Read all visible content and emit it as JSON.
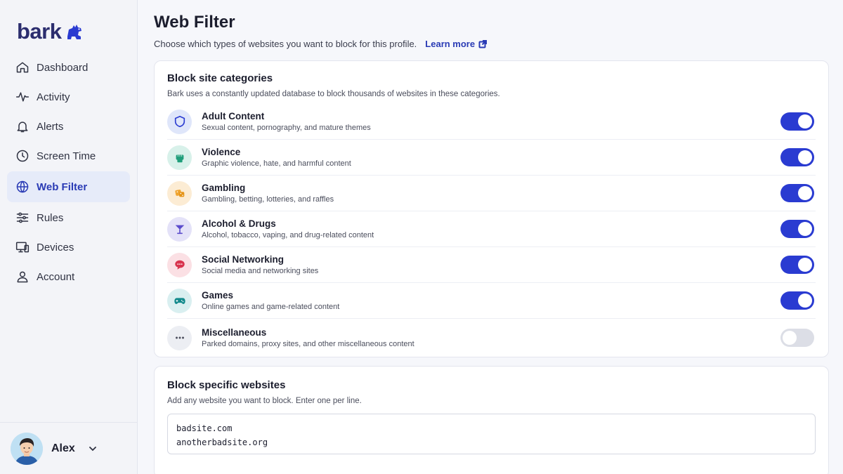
{
  "brand": {
    "name": "bark",
    "accent": "#2a3bd1",
    "logo_color": "#2b2d6e"
  },
  "sidebar": {
    "items": [
      {
        "label": "Dashboard",
        "icon": "home-icon",
        "active": false
      },
      {
        "label": "Activity",
        "icon": "pulse-icon",
        "active": false
      },
      {
        "label": "Alerts",
        "icon": "bell-icon",
        "active": false
      },
      {
        "label": "Screen Time",
        "icon": "clock-icon",
        "active": false
      },
      {
        "label": "Web Filter",
        "icon": "globe-icon",
        "active": true
      },
      {
        "label": "Rules",
        "icon": "sliders-icon",
        "active": false
      },
      {
        "label": "Devices",
        "icon": "devices-icon",
        "active": false
      },
      {
        "label": "Account",
        "icon": "user-icon",
        "active": false
      }
    ],
    "user": {
      "name": "Alex"
    }
  },
  "page": {
    "title": "Web Filter",
    "subtitle": "Choose which types of websites you want to block for this profile.",
    "learn_more": "Learn more"
  },
  "categories_card": {
    "title": "Block site categories",
    "subtitle": "Bark uses a constantly updated database to block thousands of websites in these categories.",
    "items": [
      {
        "name": "Adult Content",
        "desc": "Sexual content, pornography, and mature themes",
        "icon": "shield-icon",
        "enabled": true
      },
      {
        "name": "Violence",
        "desc": "Graphic violence, hate, and harmful content",
        "icon": "fist-icon",
        "enabled": true
      },
      {
        "name": "Gambling",
        "desc": "Gambling, betting, lotteries, and raffles",
        "icon": "dice-icon",
        "enabled": true
      },
      {
        "name": "Alcohol & Drugs",
        "desc": "Alcohol, tobacco, vaping, and drug-related content",
        "icon": "cocktail-icon",
        "enabled": true
      },
      {
        "name": "Social Networking",
        "desc": "Social media and networking sites",
        "icon": "chat-bubble-icon",
        "enabled": true
      },
      {
        "name": "Games",
        "desc": "Online games and game-related content",
        "icon": "gamepad-icon",
        "enabled": true
      },
      {
        "name": "Miscellaneous",
        "desc": "Parked domains, proxy sites, and other miscellaneous content",
        "icon": "dots-icon",
        "enabled": false
      }
    ]
  },
  "websites_card": {
    "title": "Block specific websites",
    "subtitle": "Add any website you want to block. Enter one per line.",
    "value": "badsite.com\nanotherbadsite.org"
  }
}
